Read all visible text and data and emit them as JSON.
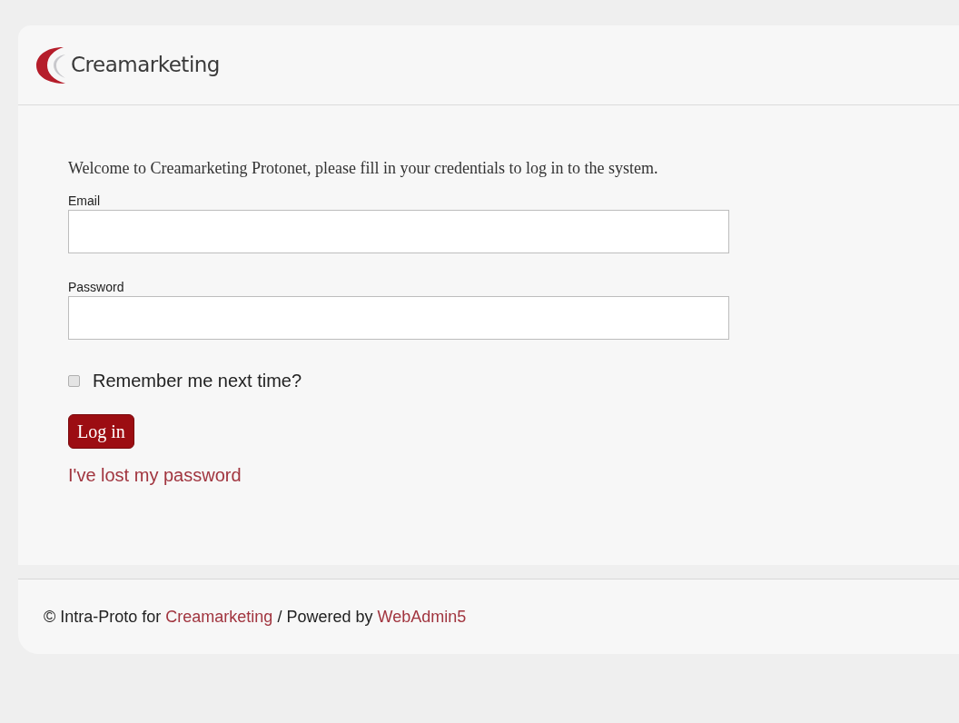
{
  "header": {
    "logo_text": "Creamarketing"
  },
  "intro": "Welcome to Creamarketing Protonet, please fill in your credentials to log in to the system.",
  "fields": [
    {
      "label": "Email"
    },
    {
      "label": "Password"
    }
  ],
  "remember": {
    "label": "Remember me next time?",
    "checked": false
  },
  "login_button": "Log in",
  "lost_password_link": "I've lost my password",
  "footer": {
    "prefix": "© Intra-Proto for",
    "link_1": "Creamarketing",
    "middle": "/ Powered by",
    "link_2": "WebAdmin5"
  }
}
